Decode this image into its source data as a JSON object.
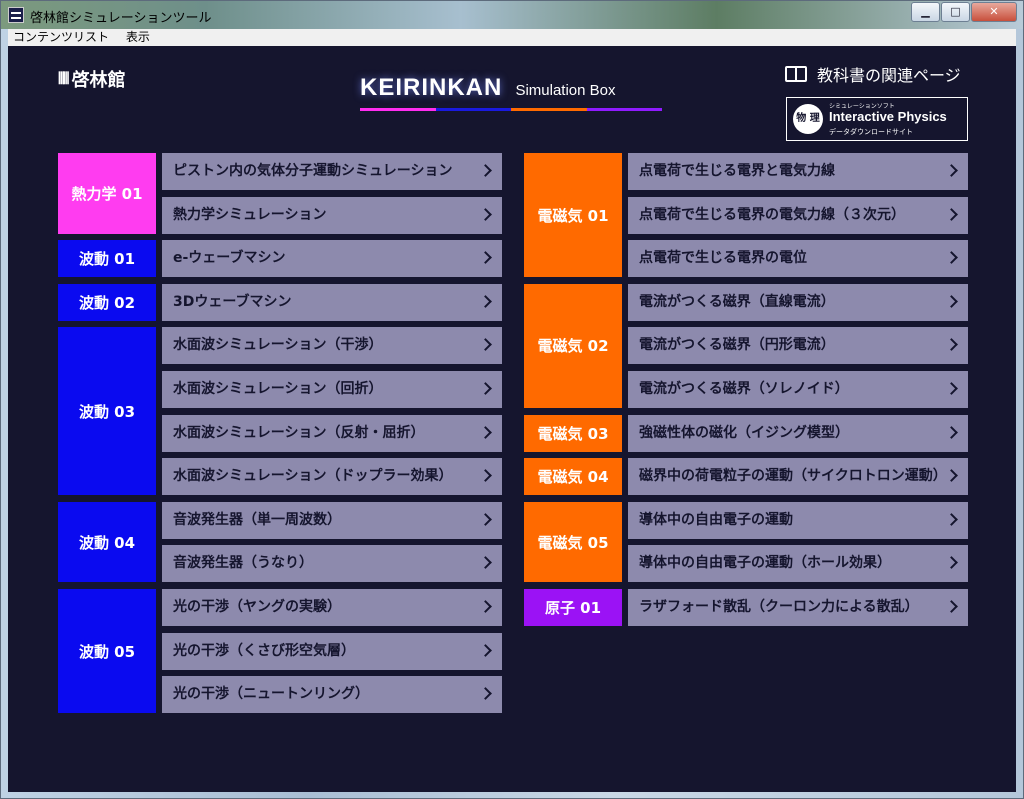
{
  "window": {
    "title": "啓林館シミュレーションツール",
    "menu": [
      "コンテンツリスト",
      "表示"
    ]
  },
  "header": {
    "logo": "啓林館",
    "brand_main": "KEIRINKAN",
    "brand_sub": "Simulation Box",
    "textbook_link": "教科書の関連ページ",
    "ip_badge": {
      "circle": "物 理",
      "small": "シミュレーションソフト",
      "name": "Interactive Physics",
      "sub": "データダウンロードサイト"
    },
    "brand_colors": [
      "#ff2df0",
      "#1a1ae0",
      "#ff6a00",
      "#8f1bff"
    ]
  },
  "colors": {
    "thermo": "#ff3cf0",
    "wave": "#0a0af0",
    "em": "#ff6a00",
    "atom": "#9b12f5",
    "item_bg": "#8d8aad",
    "background": "#15152e"
  },
  "left_column": [
    {
      "label": "熱力学 01",
      "color": "#ff3cf0",
      "items": [
        "ピストン内の気体分子運動シミュレーション",
        "熱力学シミュレーション"
      ]
    },
    {
      "label": "波動 01",
      "color": "#0a0af0",
      "items": [
        "e-ウェーブマシン"
      ]
    },
    {
      "label": "波動 02",
      "color": "#0a0af0",
      "items": [
        "3Dウェーブマシン"
      ]
    },
    {
      "label": "波動 03",
      "color": "#0a0af0",
      "items": [
        "水面波シミュレーション（干渉）",
        "水面波シミュレーション（回折）",
        "水面波シミュレーション（反射・屈折）",
        "水面波シミュレーション（ドップラー効果）"
      ]
    },
    {
      "label": "波動 04",
      "color": "#0a0af0",
      "items": [
        "音波発生器（単一周波数）",
        "音波発生器（うなり）"
      ]
    },
    {
      "label": "波動 05",
      "color": "#0a0af0",
      "items": [
        "光の干渉（ヤングの実験）",
        "光の干渉（くさび形空気層）",
        "光の干渉（ニュートンリング）"
      ]
    }
  ],
  "right_column": [
    {
      "label": "電磁気 01",
      "color": "#ff6a00",
      "items": [
        "点電荷で生じる電界と電気力線",
        "点電荷で生じる電界の電気力線（３次元）",
        "点電荷で生じる電界の電位"
      ]
    },
    {
      "label": "電磁気 02",
      "color": "#ff6a00",
      "items": [
        "電流がつくる磁界（直線電流）",
        "電流がつくる磁界（円形電流）",
        "電流がつくる磁界（ソレノイド）"
      ]
    },
    {
      "label": "電磁気 03",
      "color": "#ff6a00",
      "items": [
        "強磁性体の磁化（イジング模型）"
      ]
    },
    {
      "label": "電磁気 04",
      "color": "#ff6a00",
      "items": [
        "磁界中の荷電粒子の運動（サイクロトロン運動）"
      ]
    },
    {
      "label": "電磁気 05",
      "color": "#ff6a00",
      "items": [
        "導体中の自由電子の運動",
        "導体中の自由電子の運動（ホール効果）"
      ]
    },
    {
      "label": "原子 01",
      "color": "#9b12f5",
      "items": [
        "ラザフォード散乱（クーロン力による散乱）"
      ]
    }
  ]
}
